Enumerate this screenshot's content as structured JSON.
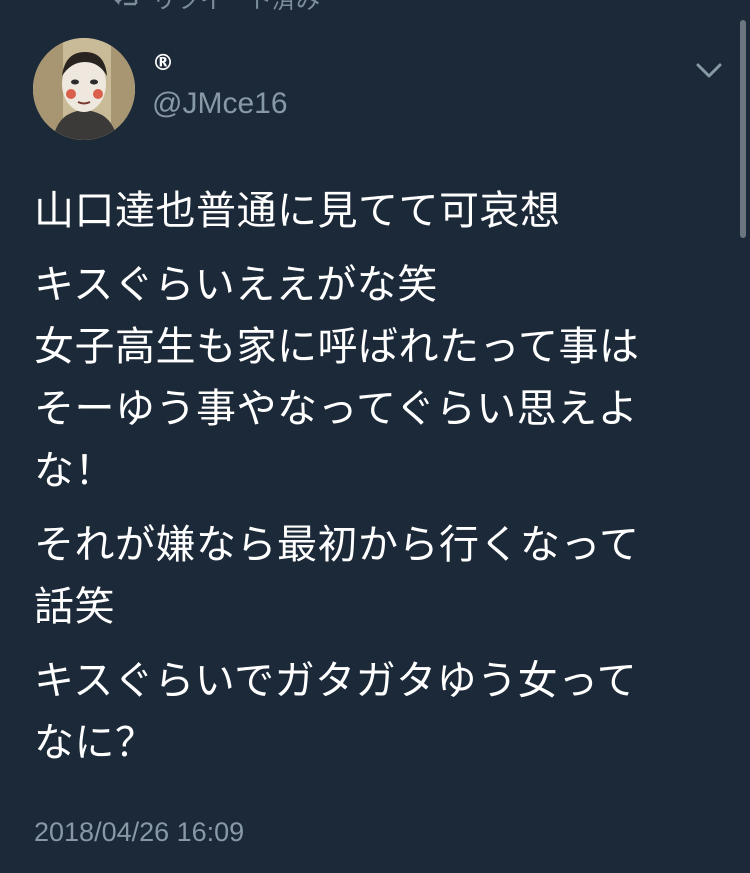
{
  "retweet_header": {
    "text": "リツイート済み"
  },
  "author": {
    "display_name": "®",
    "handle": "@JMce16"
  },
  "tweet": {
    "paragraphs": [
      [
        "山口達也普通に見てて可哀想"
      ],
      [
        "キスぐらいええがな笑",
        "女子高生も家に呼ばれたって事は",
        "そーゆう事やなってぐらい思えよ",
        "な！"
      ],
      [
        "それが嫌なら最初から行くなって",
        "話笑"
      ],
      [
        "キスぐらいでガタガタゆう女って",
        "なに？"
      ]
    ],
    "timestamp": "2018/04/26 16:09"
  },
  "colors": {
    "background": "#1c2938",
    "text": "#ffffff",
    "secondary": "#8899a6"
  },
  "icons": {
    "retweet": "retweet-icon",
    "menu": "chevron-down-icon"
  }
}
